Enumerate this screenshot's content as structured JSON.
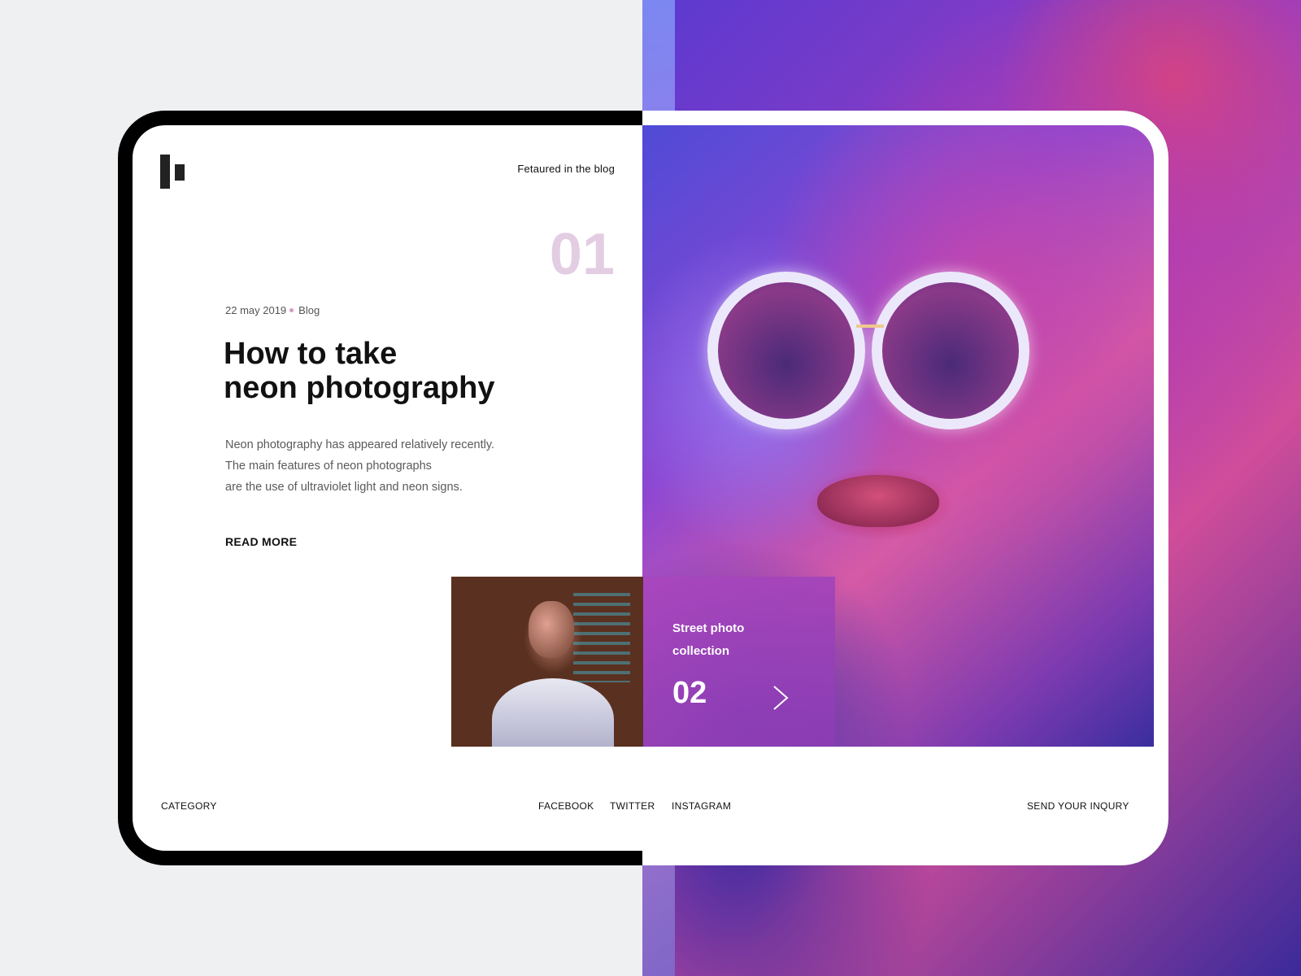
{
  "header": {
    "featured_label": "Fetaured in the blog"
  },
  "hero": {
    "number": "01",
    "date": "22 may 2019",
    "category": "Blog",
    "title_line1": "How to take",
    "title_line2": "neon photography",
    "description_line1": "Neon photography has appeared relatively recently.",
    "description_line2": "The main features of neon photographs",
    "description_line3": "are the use of ultraviolet light and neon signs.",
    "read_more_label": "READ MORE"
  },
  "next_card": {
    "label_line1": "Street photo",
    "label_line2": "collection",
    "number": "02",
    "arrow_icon": "chevron-right-icon"
  },
  "footer": {
    "category": "CATEGORY",
    "social": [
      "FACEBOOK",
      "TWITTER",
      "INSTAGRAM"
    ],
    "inquiry": "SEND YOUR INQURY"
  },
  "colors": {
    "accent_number": "#e3cde3",
    "dot": "#d699c6",
    "card_overlay": "#a046be",
    "background": "#eff0f2"
  }
}
